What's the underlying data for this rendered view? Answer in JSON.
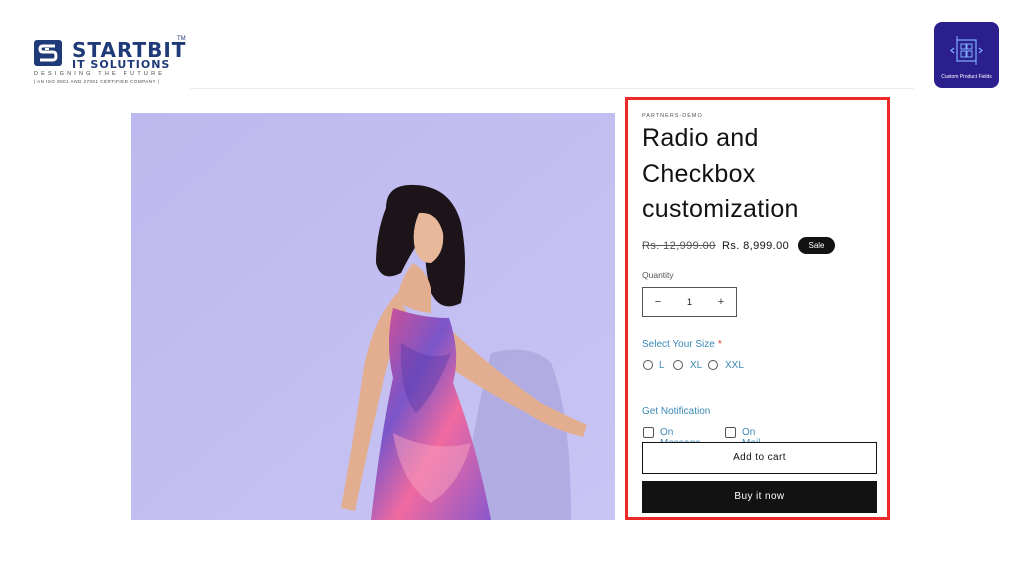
{
  "brand": {
    "name": "STARTBIT",
    "sub": "IT SOLUTIONS",
    "tm": "TM",
    "tagline": "DESIGNING THE FUTURE",
    "certification": "| AN ISO 9001 AND 27001 CERTIFIED COMPANY |"
  },
  "app_badge": {
    "label": "Custom Product Fields",
    "icon": "app-grid-icon",
    "color": "#2a1f8c"
  },
  "product": {
    "image": "model-in-floral-dress-photo",
    "vendor": "PARTNERS-DEMO",
    "title": "Radio and Checkbox customization",
    "compare_price": "Rs. 12,999.00",
    "sale_price": "Rs. 8,999.00",
    "sale_badge": "Sale"
  },
  "quantity": {
    "label": "Quantity",
    "minus": "−",
    "value": "1",
    "plus": "+"
  },
  "size": {
    "label": "Select Your Size",
    "required_mark": "*",
    "options": [
      "L",
      "XL",
      "XXL"
    ]
  },
  "notification": {
    "label": "Get Notification",
    "options": [
      "On Message",
      "On Mail"
    ]
  },
  "actions": {
    "add_to_cart": "Add to cart",
    "buy_now": "Buy it now"
  },
  "colors": {
    "highlight": "#ec2a2a",
    "accent_text": "#3d8ab5",
    "background_photo": "#c1bdf0",
    "button_dark": "#121212"
  }
}
